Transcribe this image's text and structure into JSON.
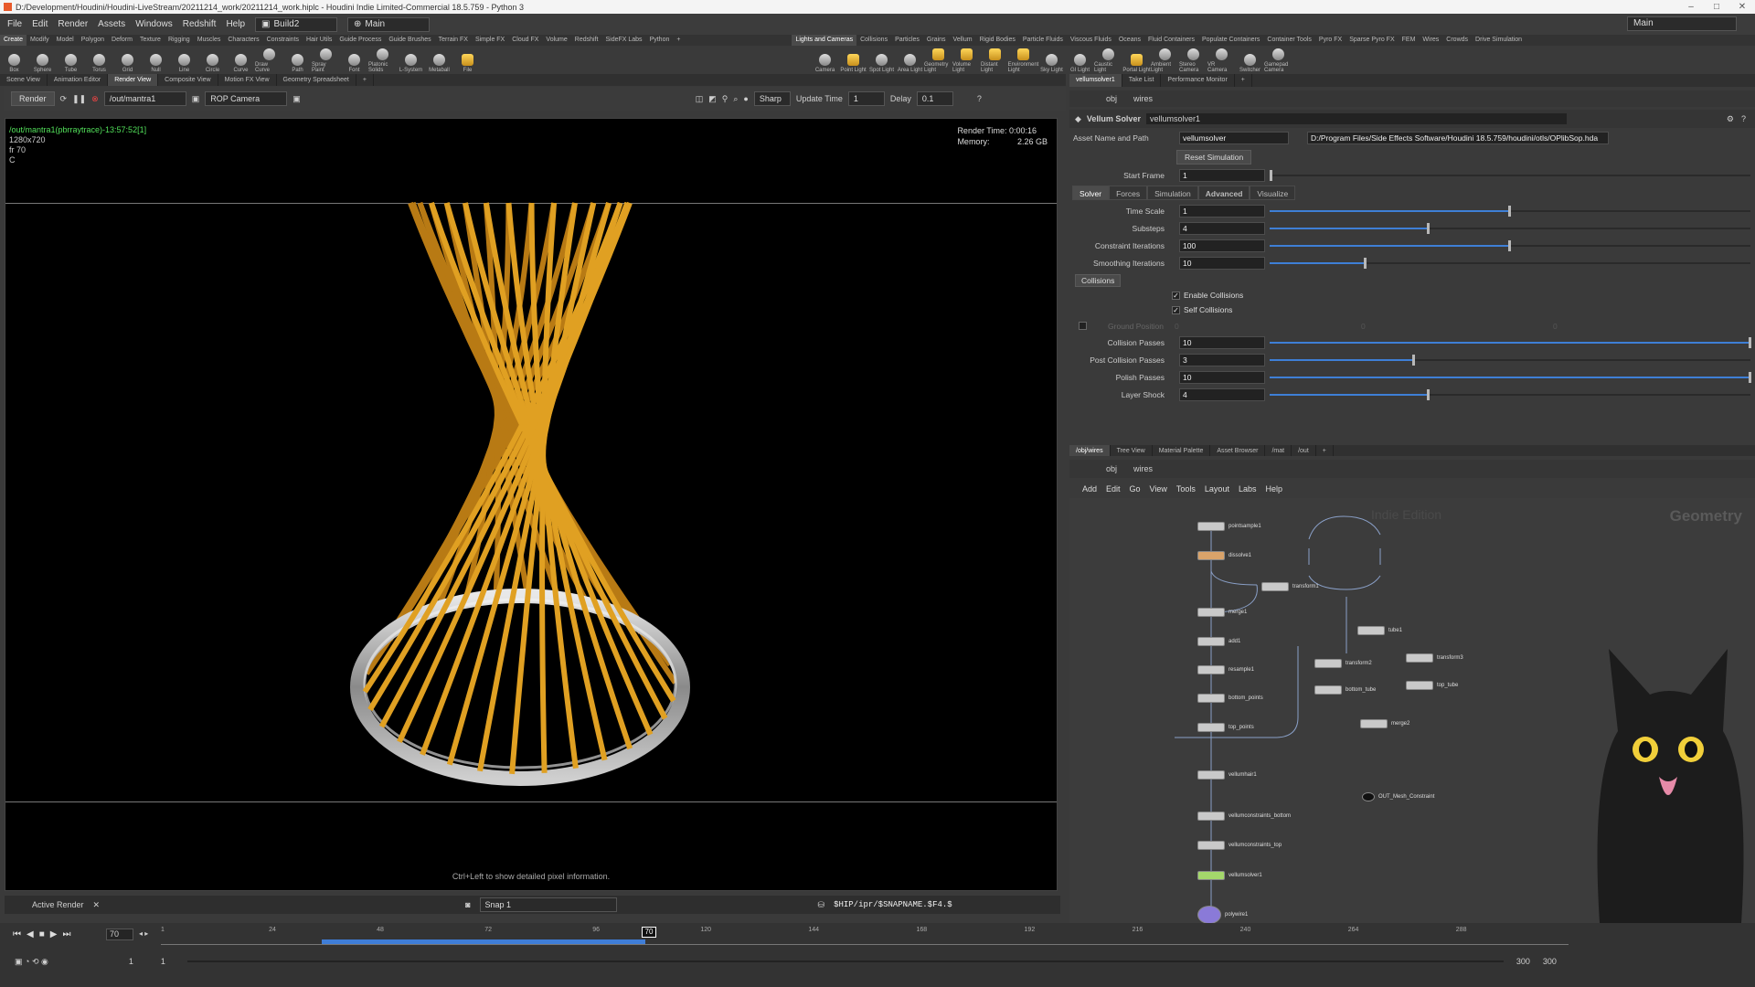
{
  "window": {
    "title": "D:/Development/Houdini/Houdini-LiveStream/20211214_work/20211214_work.hiplc - Houdini Indie Limited-Commercial 18.5.759 - Python 3"
  },
  "menu": [
    "File",
    "Edit",
    "Render",
    "Assets",
    "Windows",
    "Redshift",
    "Help"
  ],
  "desktop": "Build2",
  "main_label": "Main",
  "right_main": "Main",
  "shelf_tabs_left": [
    "Create",
    "Modify",
    "Model",
    "Polygon",
    "Deform",
    "Texture",
    "Rigging",
    "Muscles",
    "Characters",
    "Constraints",
    "Hair Utils",
    "Guide Process",
    "Guide Brushes",
    "Terrain FX",
    "Simple FX",
    "Cloud FX",
    "Volume",
    "Redshift",
    "SideFX Labs",
    "Python"
  ],
  "shelf_tabs_right": [
    "Lights and Cameras",
    "Collisions",
    "Particles",
    "Grains",
    "Vellum",
    "Rigid Bodies",
    "Particle Fluids",
    "Viscous Fluids",
    "Oceans",
    "Fluid Containers",
    "Populate Containers",
    "Container Tools",
    "Pyro FX",
    "Sparse Pyro FX",
    "FEM",
    "Wires",
    "Crowds",
    "Drive Simulation"
  ],
  "tools_left": [
    "Box",
    "Sphere",
    "Tube",
    "Torus",
    "Grid",
    "Null",
    "Line",
    "Circle",
    "Curve",
    "Draw Curve",
    "Path",
    "Spray Paint",
    "Font",
    "Platonic Solids",
    "L-System",
    "Metaball",
    "File"
  ],
  "tools_right": [
    "Camera",
    "Point Light",
    "Spot Light",
    "Area Light",
    "Geometry Light",
    "Volume Light",
    "Distant Light",
    "Environment Light",
    "Sky Light",
    "GI Light",
    "Caustic Light",
    "Portal Light",
    "Ambient Light",
    "Stereo Camera",
    "VR Camera",
    "Switcher",
    "Gamepad Camera"
  ],
  "left_tabs": [
    "Scene View",
    "Animation Editor",
    "Render View",
    "Composite View",
    "Motion FX View",
    "Geometry Spreadsheet"
  ],
  "render": {
    "button": "Render",
    "rop": "/out/mantra1",
    "camera": "ROP Camera",
    "shading": "Sharp",
    "update_label": "Update Time",
    "update_value": "1",
    "delay_label": "Delay",
    "delay_value": "0.1"
  },
  "viewport": {
    "info_path": "/out/mantra1(pbrraytrace)-13:57:52[1]",
    "info_res": "1280x720",
    "info_fr": "fr 70",
    "info_c": "C",
    "render_time": "Render Time: 0:00:16",
    "memory_label": "Memory:",
    "memory": "2.26 GB",
    "hint": "Ctrl+Left to show detailed pixel information."
  },
  "render_bottom": {
    "active": "Active Render",
    "snap": "Snap 1",
    "path": "$HIP/ipr/$SNAPNAME.$F4.$"
  },
  "right_tabs": [
    "vellumsolver1",
    "Take List",
    "Performance Monitor"
  ],
  "path_obj": "obj",
  "path_wires": "wires",
  "param": {
    "type": "Vellum Solver",
    "name": "vellumsolver1",
    "asset_label": "Asset Name and Path",
    "asset": "vellumsolver",
    "asset_path": "D:/Program Files/Side Effects Software/Houdini 18.5.759/houdini/otls/OPlibSop.hda",
    "reset": "Reset Simulation",
    "start_label": "Start Frame",
    "start": "1"
  },
  "subtabs": [
    "Solver",
    "Forces",
    "Simulation",
    "Advanced",
    "Visualize"
  ],
  "params": [
    {
      "label": "Time Scale",
      "value": "1",
      "fill": 0.5
    },
    {
      "label": "Substeps",
      "value": "4",
      "fill": 0.33
    },
    {
      "label": "Constraint Iterations",
      "value": "100",
      "fill": 0.5
    },
    {
      "label": "Smoothing Iterations",
      "value": "10",
      "fill": 0.2
    }
  ],
  "collisions": {
    "header": "Collisions",
    "enable": "Enable Collisions",
    "self": "Self Collisions",
    "ground": "Ground Position",
    "g0": "0",
    "g1": "0",
    "g2": "0"
  },
  "params2": [
    {
      "label": "Collision Passes",
      "value": "10",
      "fill": 1.0
    },
    {
      "label": "Post Collision Passes",
      "value": "3",
      "fill": 0.3
    },
    {
      "label": "Polish Passes",
      "value": "10",
      "fill": 1.0
    },
    {
      "label": "Layer Shock",
      "value": "4",
      "fill": 0.33
    }
  ],
  "net_tabs": [
    "/obj/wires",
    "Tree View",
    "Material Palette",
    "Asset Browser",
    "/mat",
    "/out"
  ],
  "net_menu": [
    "Add",
    "Edit",
    "Go",
    "View",
    "Tools",
    "Layout",
    "Labs",
    "Help"
  ],
  "net_watermark": "Indie Edition",
  "net_context": "Geometry",
  "nodes": [
    "pointsample1",
    "dissolve1",
    "transform1",
    "merge1",
    "add1",
    "resample1",
    "bottom_points",
    "top_points",
    "vellumhair1",
    "vellumconstraints_bottom",
    "vellumconstraints_top",
    "vellumsolver1",
    "polywire1",
    "tube1",
    "transform2",
    "transform3",
    "bottom_tube",
    "top_tube",
    "merge2",
    "OUT_Mesh_Constraint"
  ],
  "timeline": {
    "frame": "70",
    "ticks": [
      "1",
      "24",
      "48",
      "72",
      "96",
      "120",
      "144",
      "168",
      "192",
      "216",
      "240",
      "264",
      "288"
    ],
    "start": "1",
    "start2": "1",
    "end": "300",
    "end2": "300",
    "current": "70",
    "played_fraction": 0.23
  }
}
